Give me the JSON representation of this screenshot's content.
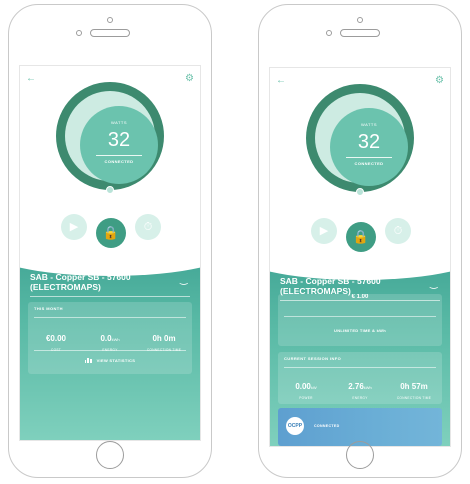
{
  "screens": [
    {
      "ring": {
        "label": "WATTS",
        "value": "32",
        "status": "CONNECTED"
      },
      "station": {
        "line1": "SAB - Copper SB - 57600",
        "line2": "(ELECTROMAPS)"
      },
      "month_card": {
        "title": "THIS MONTH",
        "stats": [
          {
            "value": "€0.00",
            "unit": "",
            "key": "COST"
          },
          {
            "value": "0.0",
            "unit": "kWh",
            "key": "ENERGY"
          },
          {
            "value": "0h 0m",
            "unit": "",
            "key": "CONNECTION TIME"
          }
        ],
        "view_label": "VIEW STATISTICS"
      }
    },
    {
      "ring": {
        "label": "WATTS",
        "value": "32",
        "status": "CONNECTED"
      },
      "station": {
        "line1": "SAB - Copper SB - 57600",
        "line2": "(ELECTROMAPS)"
      },
      "tariff_card": {
        "top_cut": "€ 1.00",
        "label": "UNLIMITED TIME & kWh"
      },
      "session_card": {
        "title": "CURRENT SESSION INFO",
        "stats": [
          {
            "value": "0.00",
            "unit": "kW",
            "key": "POWER"
          },
          {
            "value": "2.76",
            "unit": "kWh",
            "key": "ENERGY"
          },
          {
            "value": "0h 57m",
            "unit": "",
            "key": "CONNECTION TIME"
          }
        ]
      },
      "ocpp": {
        "logo": "OCPP",
        "status": "CONNECTED"
      }
    }
  ],
  "icons": {
    "back": "back-arrow-icon",
    "settings": "gear-icon",
    "play": "play-icon",
    "lock": "lock-icon",
    "timer": "timer-icon",
    "plug": "plug-icon",
    "stats": "bar-chart-icon"
  },
  "colors": {
    "teal": "#58b9a5",
    "dark_green": "#3d8a6f",
    "ocpp_blue": "#6aaed6"
  }
}
